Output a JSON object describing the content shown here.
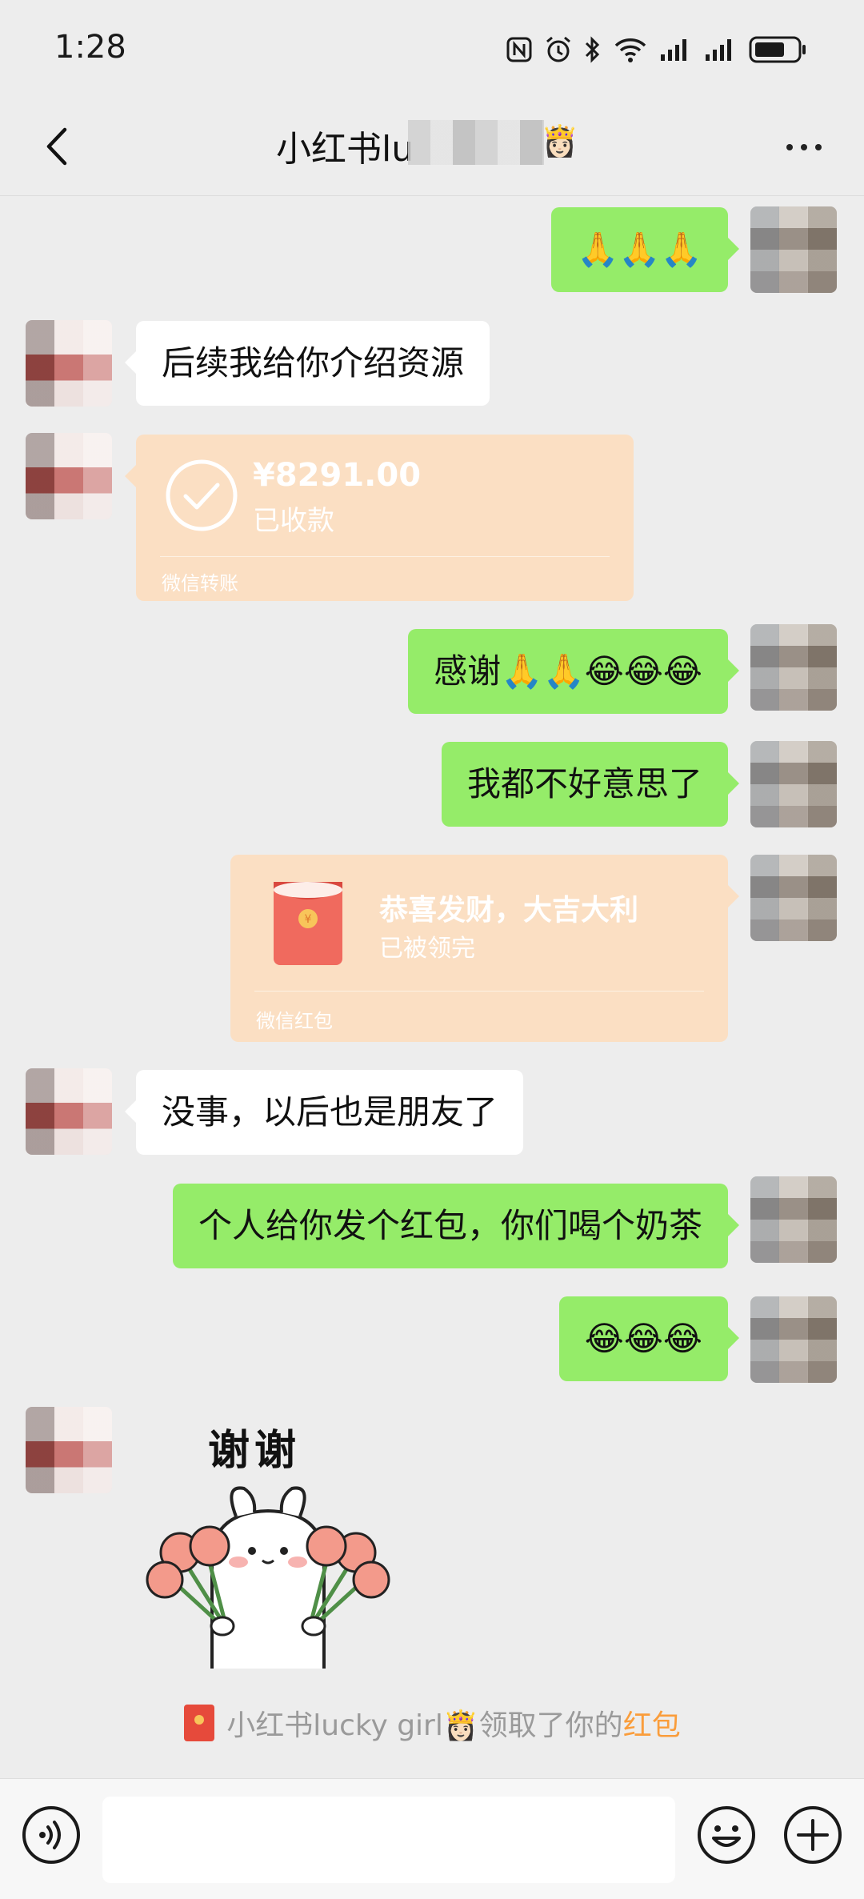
{
  "status_bar": {
    "time": "1:28",
    "icons": [
      "nfc-icon",
      "alarm-icon",
      "bluetooth-icon",
      "wifi-icon",
      "signal-icon",
      "signal-icon",
      "battery-icon"
    ]
  },
  "header": {
    "title_visible": "小红书lu",
    "title_emoji": "👸🏻"
  },
  "messages": [
    {
      "sender": "me",
      "type": "text",
      "text": "🙏🙏🙏"
    },
    {
      "sender": "contact",
      "type": "text",
      "text": "后续我给你介绍资源"
    },
    {
      "sender": "contact",
      "type": "transfer",
      "amount": "¥8291.00",
      "status": "已收款",
      "footer": "微信转账"
    },
    {
      "sender": "me",
      "type": "text",
      "text": "感谢🙏🙏😂😂😂"
    },
    {
      "sender": "me",
      "type": "text",
      "text": "我都不好意思了"
    },
    {
      "sender": "me",
      "type": "red_packet",
      "title": "恭喜发财，大吉大利",
      "status": "已被领完",
      "footer": "微信红包"
    },
    {
      "sender": "contact",
      "type": "text",
      "text": "没事，以后也是朋友了"
    },
    {
      "sender": "me",
      "type": "text",
      "text": "个人给你发个红包，你们喝个奶茶"
    },
    {
      "sender": "me",
      "type": "text",
      "text": "😂😂😂"
    },
    {
      "sender": "contact",
      "type": "sticker",
      "caption": "谢谢"
    }
  ],
  "system_message": {
    "prefix": "小红书lucky girl👸🏻领取了你的",
    "link": "红包"
  },
  "input_bar": {
    "placeholder": ""
  },
  "colors": {
    "background": "#ededed",
    "my_bubble": "#95ec69",
    "their_bubble": "#ffffff",
    "card": "#fbdfc3",
    "link": "#fa9d3b"
  }
}
